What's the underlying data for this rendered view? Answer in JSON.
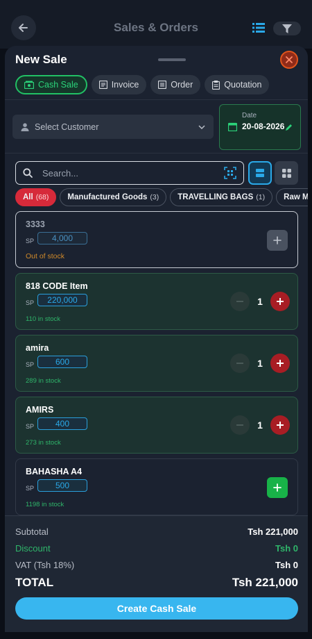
{
  "topbar": {
    "title": "Sales & Orders"
  },
  "sheet": {
    "title": "New Sale",
    "sale_types": [
      {
        "label": "Cash Sale",
        "icon": "cash-icon",
        "active": true
      },
      {
        "label": "Invoice",
        "icon": "invoice-icon",
        "active": false
      },
      {
        "label": "Order",
        "icon": "order-icon",
        "active": false
      },
      {
        "label": "Quotation",
        "icon": "quotation-icon",
        "active": false
      }
    ],
    "customer": {
      "placeholder": "Select Customer"
    },
    "date": {
      "label": "Date",
      "value": "20-08-2026"
    },
    "search": {
      "placeholder": "Search..."
    },
    "categories": [
      {
        "label": "All",
        "count": "(68)",
        "active": true
      },
      {
        "label": "Manufactured Goods",
        "count": "(3)",
        "active": false
      },
      {
        "label": "TRAVELLING BAGS",
        "count": "(1)",
        "active": false
      },
      {
        "label": "Raw Mate",
        "count": "",
        "active": false
      }
    ],
    "sp_label": "SP",
    "products": [
      {
        "name": "3333",
        "price": "4,000",
        "stock": "Out of stock",
        "qty": null,
        "out_of_stock": true
      },
      {
        "name": "818 CODE Item",
        "price": "220,000",
        "stock": "110 in stock",
        "qty": "1",
        "out_of_stock": false
      },
      {
        "name": "amira",
        "price": "600",
        "stock": "289 in stock",
        "qty": "1",
        "out_of_stock": false
      },
      {
        "name": "AMIRS",
        "price": "400",
        "stock": "273 in stock",
        "qty": "1",
        "out_of_stock": false
      },
      {
        "name": "BAHASHA A4",
        "price": "500",
        "stock": "1198 in stock",
        "qty": null,
        "out_of_stock": false
      }
    ],
    "summary": {
      "subtotal_label": "Subtotal",
      "subtotal": "Tsh 221,000",
      "discount_label": "Discount",
      "discount": "Tsh 0",
      "vat_label": "VAT (Tsh 18%)",
      "vat": "Tsh 0",
      "total_label": "TOTAL",
      "total": "Tsh 221,000"
    },
    "create_button": "Create Cash Sale"
  },
  "colors": {
    "accent": "#38b6ef",
    "success": "#22c065",
    "danger": "#d62a3a"
  }
}
